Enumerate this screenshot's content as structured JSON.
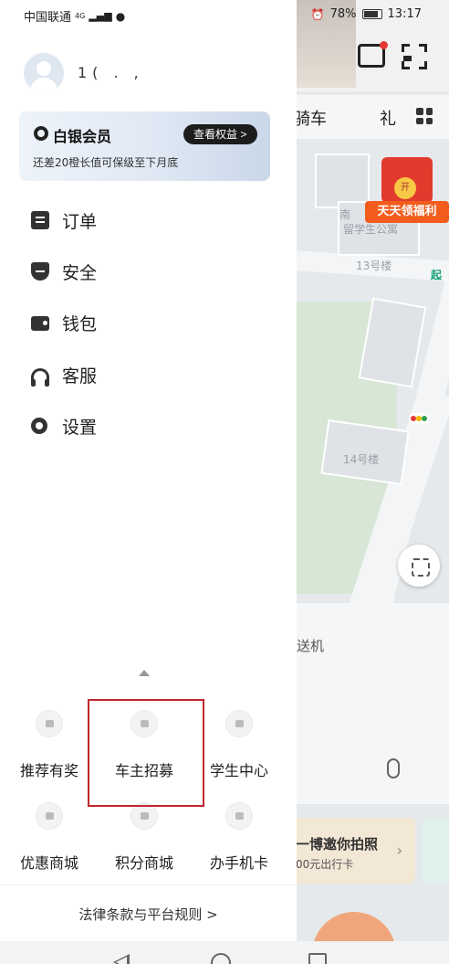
{
  "status_bar": {
    "carrier": "中国联通",
    "network": "4G",
    "battery": "78%",
    "time": "13:17"
  },
  "drawer": {
    "user_name": "1( . ,",
    "vip": {
      "title": "白银会员",
      "subtitle": "还差20橙长值可保级至下月底",
      "button": "查看权益 >"
    },
    "menu": [
      {
        "label": "订单",
        "icon": "order-icon"
      },
      {
        "label": "安全",
        "icon": "shield-icon"
      },
      {
        "label": "钱包",
        "icon": "wallet-icon"
      },
      {
        "label": "客服",
        "icon": "headset-icon"
      },
      {
        "label": "设置",
        "icon": "gear-icon"
      }
    ],
    "services": [
      {
        "label": "推荐有奖",
        "icon": "gift-icon"
      },
      {
        "label": "车主招募",
        "icon": "driver-icon"
      },
      {
        "label": "学生中心",
        "icon": "student-cap-icon"
      },
      {
        "label": "优惠商城",
        "icon": "coupon-icon"
      },
      {
        "label": "积分商城",
        "icon": "cart-icon"
      },
      {
        "label": "办手机卡",
        "icon": "sim-card-icon"
      }
    ],
    "legal": "法律条款与平台规则 >"
  },
  "background": {
    "tab_ride": "骑车",
    "tab_other": "礼",
    "welfare_badge": "开",
    "welfare": "天天领福利",
    "map_labels": [
      "南",
      "留学生公寓",
      "13号楼",
      "14号楼",
      "起"
    ],
    "send_label": "送机",
    "promo_title": "一博邀你拍照",
    "promo_sub": "00元出行卡"
  }
}
